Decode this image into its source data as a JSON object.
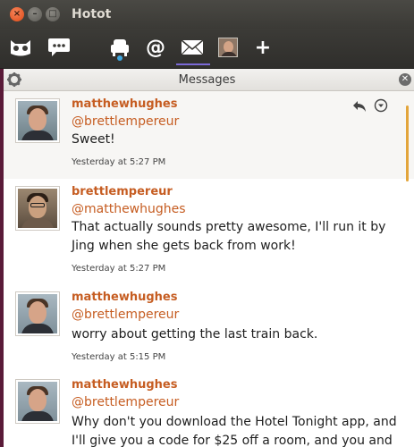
{
  "window": {
    "title": "Hotot"
  },
  "toolbar": {
    "icons": [
      "owl-icon",
      "chat-icon",
      "home-icon",
      "mention-icon",
      "messages-icon",
      "profile-avatar",
      "add-icon"
    ],
    "active": "messages-icon",
    "at_label": "@",
    "plus_label": "+"
  },
  "column": {
    "title": "Messages"
  },
  "messages": [
    {
      "name": "matthewhughes",
      "to": "@brettlempereur",
      "text": "Sweet!",
      "time": "Yesterday at 5:27 PM"
    },
    {
      "name": "brettlempereur",
      "to": "@matthewhughes",
      "text": "That actually sounds pretty awesome, I'll run it by Jing when she gets back from work!",
      "time": "Yesterday at 5:27 PM"
    },
    {
      "name": "matthewhughes",
      "to": "@brettlempereur",
      "text": "worry about getting the last train back.",
      "time": "Yesterday at 5:15 PM"
    },
    {
      "name": "matthewhughes",
      "to": "@brettlempereur",
      "text": "Why don't you download the Hotel Tonight app, and I'll give you a code for $25 off a room, and you and",
      "time": ""
    }
  ],
  "colors": {
    "accent": "#c65d22",
    "active_tab": "#7b69d6",
    "scrollbar": "#e3a53b"
  }
}
